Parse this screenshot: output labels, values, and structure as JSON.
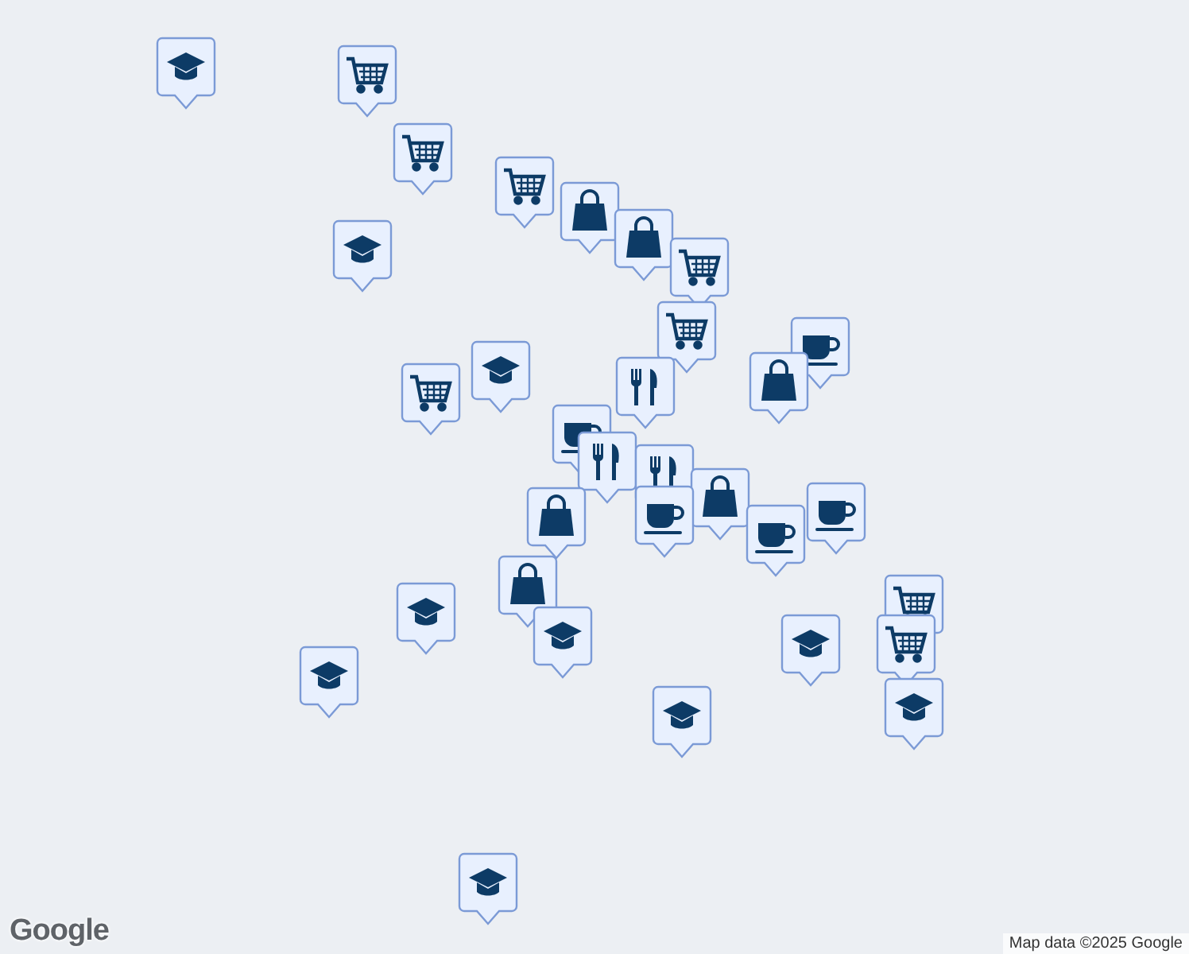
{
  "markers": [
    {
      "kind": "school"
    },
    {
      "kind": "cart"
    },
    {
      "kind": "cart"
    },
    {
      "kind": "school"
    },
    {
      "kind": "cart"
    },
    {
      "kind": "bag"
    },
    {
      "kind": "bag"
    },
    {
      "kind": "cart"
    },
    {
      "kind": "cart"
    },
    {
      "kind": "school"
    },
    {
      "kind": "cart"
    },
    {
      "kind": "coffee"
    },
    {
      "kind": "restaurant"
    },
    {
      "kind": "bag"
    },
    {
      "kind": "coffee"
    },
    {
      "kind": "restaurant"
    },
    {
      "kind": "restaurant"
    },
    {
      "kind": "bag"
    },
    {
      "kind": "coffee"
    },
    {
      "kind": "coffee"
    },
    {
      "kind": "coffee"
    },
    {
      "kind": "bag"
    },
    {
      "kind": "bag"
    },
    {
      "kind": "school"
    },
    {
      "kind": "school"
    },
    {
      "kind": "school"
    },
    {
      "kind": "school"
    },
    {
      "kind": "cart"
    },
    {
      "kind": "cart"
    },
    {
      "kind": "school"
    },
    {
      "kind": "school"
    },
    {
      "kind": "school"
    }
  ],
  "logo": "Google",
  "attribution": "Map data ©2025 Google"
}
